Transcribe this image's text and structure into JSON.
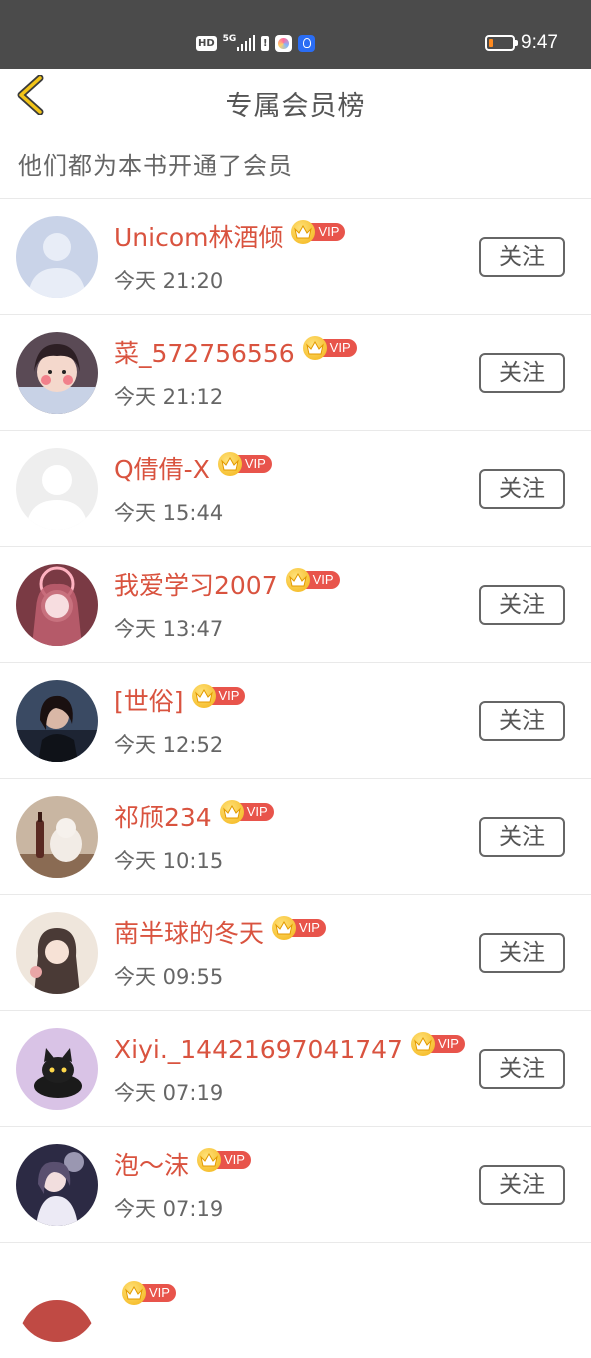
{
  "status_bar": {
    "hd": "HD",
    "net": "5G",
    "time": "9:47",
    "battery_level": 0.18,
    "battery_color": "#ff8a1f"
  },
  "header": {
    "back_icon": "chevron-left-icon",
    "title": "专属会员榜"
  },
  "subtitle": "他们都为本书开通了会员",
  "colors": {
    "name": "#d9533f",
    "vip_tag": "#e8544b",
    "crown": "#f3b316"
  },
  "vip_label": "VIP",
  "follow_label": "关注",
  "members": [
    {
      "name": "Unicom林酒倾",
      "time": "今天 21:20",
      "avatar": "default-gray"
    },
    {
      "name": "菜_572756556",
      "time": "今天 21:12",
      "avatar": "girl-photo"
    },
    {
      "name": "Q倩倩-X",
      "time": "今天 15:44",
      "avatar": "default-light"
    },
    {
      "name": "我爱学习2007",
      "time": "今天 13:47",
      "avatar": "anime-pink"
    },
    {
      "name": "[世俗]",
      "time": "今天 12:52",
      "avatar": "dark-portrait"
    },
    {
      "name": "祁颀234",
      "time": "今天 10:15",
      "avatar": "cat-bottle"
    },
    {
      "name": "南半球的冬天",
      "time": "今天 09:55",
      "avatar": "anime-girl"
    },
    {
      "name": "Xiyi._14421697041747",
      "time": "今天 07:19",
      "avatar": "black-cat"
    },
    {
      "name": "泡～沫",
      "time": "今天 07:19",
      "avatar": "fantasy-girl"
    },
    {
      "name": "",
      "time": "",
      "avatar": "partial"
    }
  ]
}
